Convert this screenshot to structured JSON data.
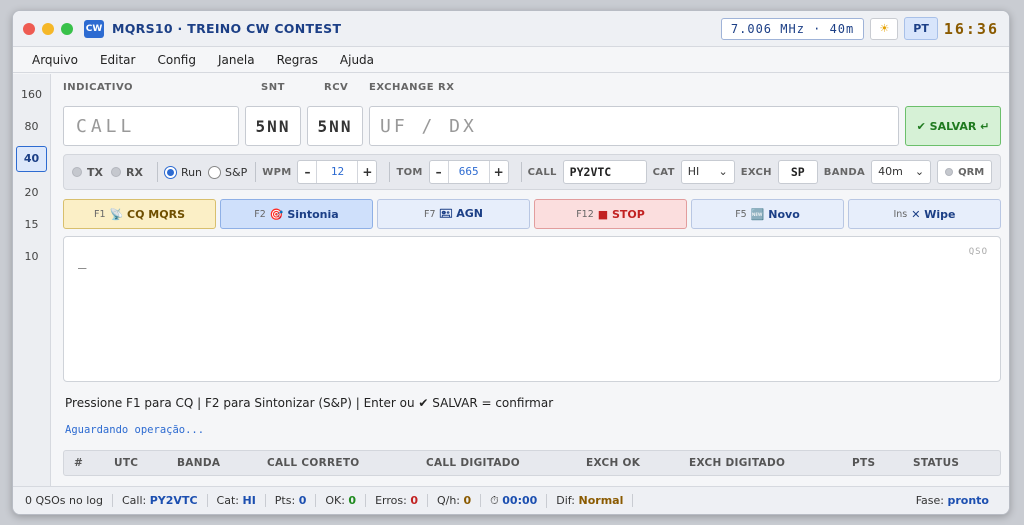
{
  "window": {
    "app_icon": "CW",
    "title": "MQRS10 · TREINO CW CONTEST",
    "frequency": "7.006 MHz · 40m",
    "lang": "PT",
    "clock": "16:36",
    "sun_icon": "sun-icon"
  },
  "menu": [
    "Arquivo",
    "Editar",
    "Config",
    "Janela",
    "Regras",
    "Ajuda"
  ],
  "bands": [
    "160",
    "80",
    "40",
    "20",
    "15",
    "10"
  ],
  "active_band": "40",
  "entry": {
    "call_label": "INDICATIVO",
    "call_placeholder": "CALL",
    "snt_label": "SNT",
    "snt_value": "5NN",
    "rcv_label": "RCV",
    "rcv_value": "5NN",
    "exch_label": "EXCHANGE RX",
    "exch_placeholder": "UF / DX",
    "save_label": "✔ SALVAR ↵"
  },
  "controls": {
    "tx": "TX",
    "rx": "RX",
    "run": "Run",
    "sp": "S&P",
    "wpm_label": "WPM",
    "wpm": "12",
    "tom_label": "TOM",
    "tom": "665",
    "call_label": "CALL",
    "call": "PY2VTC",
    "cat_label": "CAT",
    "cat": "HI",
    "exch_label": "EXCH",
    "exch": "SP",
    "banda_label": "BANDA",
    "banda": "40m",
    "qrm": "QRM",
    "minus": "–",
    "plus": "+",
    "caret": "⌄"
  },
  "fkeys": [
    {
      "key": "F1",
      "label": "📡 CQ MQRS"
    },
    {
      "key": "F2",
      "label": "🎯 Sintonia"
    },
    {
      "key": "F7",
      "label": "🖭 AGN"
    },
    {
      "key": "F12",
      "label": "■ STOP"
    },
    {
      "key": "F5",
      "label": "🆕 Novo"
    },
    {
      "key": "Ins",
      "label": "✕ Wipe"
    }
  ],
  "qso": {
    "cursor": "_",
    "tag": "QSO"
  },
  "hint": "Pressione F1 para CQ | F2 para Sintonizar (S&P) | Enter ou ✔ SALVAR = confirmar",
  "waiting": "Aguardando operação...",
  "log_columns": [
    "#",
    "UTC",
    "BANDA",
    "CALL CORRETO",
    "CALL DIGITADO",
    "EXCH OK",
    "EXCH DIGITADO",
    "PTS",
    "STATUS"
  ],
  "status": {
    "qsos": "0 QSOs no log",
    "call_label": "Call:",
    "call": "PY2VTC",
    "cat_label": "Cat:",
    "cat": "HI",
    "pts_label": "Pts:",
    "pts": "0",
    "ok_label": "OK:",
    "ok": "0",
    "err_label": "Erros:",
    "err": "0",
    "qh_label": "Q/h:",
    "qh": "0",
    "timer_icon": "⏱",
    "timer": "00:00",
    "dif_label": "Dif:",
    "dif": "Normal",
    "phase_label": "Fase:",
    "phase": "pronto"
  }
}
